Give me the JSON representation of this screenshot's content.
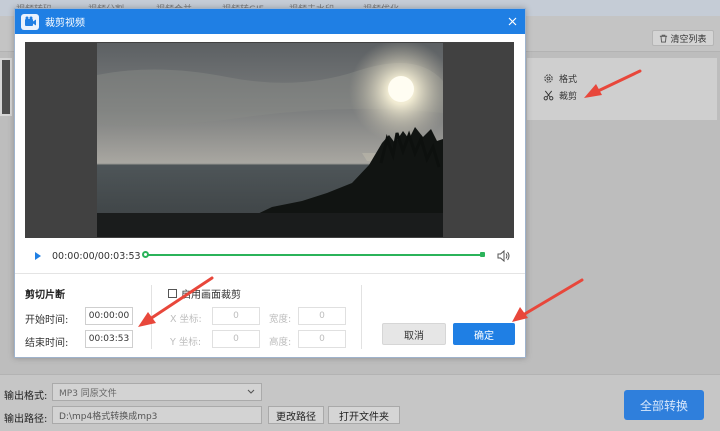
{
  "background_app": {
    "tabs": [
      "视频转码",
      "视频分割",
      "视频合并",
      "视频转GIF",
      "视频去水印",
      "视频优化"
    ],
    "clear_list_label": "清空列表",
    "side_options": {
      "format_label": "格式",
      "crop_label": "裁剪"
    },
    "footer": {
      "output_format_label": "输出格式:",
      "output_format_value": "MP3  同原文件",
      "output_path_label": "输出路径:",
      "output_path_value": "D:\\mp4格式转换成mp3",
      "change_path_label": "更改路径",
      "open_folder_label": "打开文件夹",
      "convert_all_label": "全部转换"
    }
  },
  "dialog": {
    "title": "裁剪视频",
    "player": {
      "time_readout": "00:00:00/00:03:53",
      "progress": 0,
      "clip_start": 0,
      "clip_end": 1
    },
    "clip_section": {
      "title": "剪切片断",
      "start_label": "开始时间:",
      "start_value": "00:00:00",
      "end_label": "结束时间:",
      "end_value": "00:03:53"
    },
    "crop_section": {
      "enable_label": "启用画面裁剪",
      "enabled": false,
      "x_label": "X 坐标:",
      "x_value": "0",
      "width_label": "宽度:",
      "width_value": "0",
      "y_label": "Y 坐标:",
      "y_value": "0",
      "height_label": "高度:",
      "height_value": "0"
    },
    "cancel_label": "取消",
    "ok_label": "确定"
  },
  "colors": {
    "accent_blue": "#1f7fe4",
    "timeline_green": "#2bb35a",
    "annotation_red": "#e8473b"
  }
}
